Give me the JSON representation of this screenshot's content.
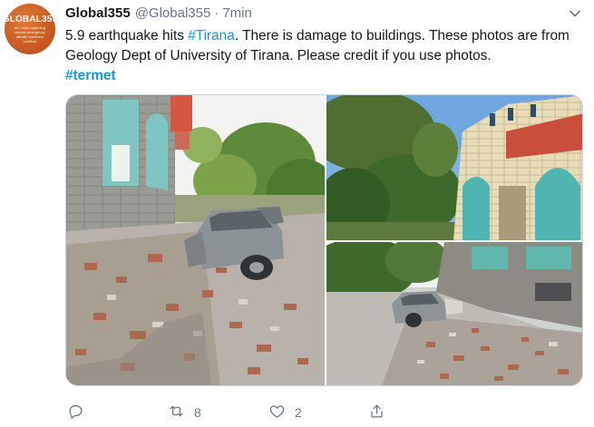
{
  "tweet": {
    "avatar": {
      "logo_text": "GLOBAL355",
      "logo_sub": "the voice regarding climate emergency climate resilience conflicts"
    },
    "author_name": "Global355",
    "author_handle": "@Global355",
    "separator": "·",
    "timestamp": "7min",
    "text_before_tag": "5.9 earthquake hits ",
    "tag_link": "#Tirana",
    "text_after_tag": ". There is damage to buildings. These photos are from Geology Dept of University of Tirana. Please credit if you use photos.",
    "hashtag": "#termet",
    "media": [
      {
        "icon": "photo-car-rubble"
      },
      {
        "icon": "photo-building-trees"
      },
      {
        "icon": "photo-street-rubble"
      }
    ],
    "actions": {
      "reply_count": "",
      "retweet_count": "8",
      "like_count": "2",
      "share_count": ""
    }
  },
  "colors": {
    "link": "#1b95e0",
    "muted": "#657786",
    "avatar": "#c4561e"
  }
}
